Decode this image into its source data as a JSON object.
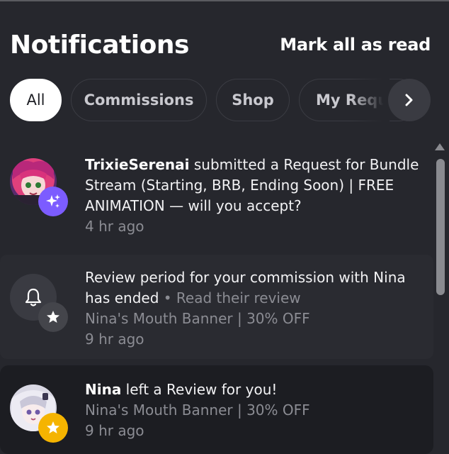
{
  "header": {
    "title": "Notifications",
    "mark_all": "Mark all as read"
  },
  "tabs": [
    {
      "label": "All",
      "active": true
    },
    {
      "label": "Commissions"
    },
    {
      "label": "Shop"
    },
    {
      "label": "My Requests"
    }
  ],
  "tabs_next_icon": "chevron-right-icon",
  "notifications": [
    {
      "actor": "TrixieSerenai",
      "message": " submitted a Request for Bundle Stream (Starting, BRB, Ending Soon) | FREE ANIMATION — will you accept?",
      "time": "4 hr ago",
      "badge_icon": "sparkles-icon",
      "badge_color": "#7c5cff"
    },
    {
      "message": "Review period for your commission with Nina has ended",
      "separator": " • ",
      "link": "Read their review",
      "subtitle": "Nina's Mouth Banner | 30% OFF",
      "time": "9 hr ago",
      "icon": "bell-icon",
      "badge_icon": "star-icon",
      "badge_color": "#44454b"
    },
    {
      "actor": "Nina",
      "message": " left a Review for you!",
      "subtitle": "Nina's Mouth Banner | 30% OFF",
      "time": "9 hr ago",
      "badge_icon": "star-icon",
      "badge_color": "#f5b400"
    }
  ]
}
